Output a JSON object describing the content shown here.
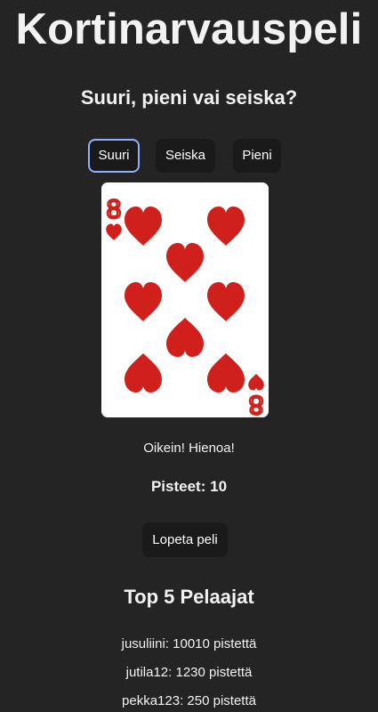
{
  "app": {
    "title": "Kortinarvauspeli",
    "question": "Suuri, pieni vai seiska?"
  },
  "choices": {
    "high_label": "Suuri",
    "seven_label": "Seiska",
    "low_label": "Pieni",
    "selected": "Suuri"
  },
  "card": {
    "rank": "8",
    "suit": "hearts",
    "color": "#d0201c"
  },
  "result": {
    "message": "Oikein! Hienoa!"
  },
  "score": {
    "label": "Pisteet:",
    "value": "10"
  },
  "actions": {
    "end_game_label": "Lopeta peli"
  },
  "leaderboard": {
    "title": "Top 5 Pelaajat",
    "entries": [
      {
        "text": "jusuliini: 10010 pistettä"
      },
      {
        "text": "jutila12: 1230 pistettä"
      },
      {
        "text": "pekka123: 250 pistettä"
      }
    ]
  },
  "colors": {
    "background": "#242424",
    "button_bg": "#1a1a1a",
    "focus_ring": "#8fb0ff",
    "heart_red": "#d0201c"
  }
}
